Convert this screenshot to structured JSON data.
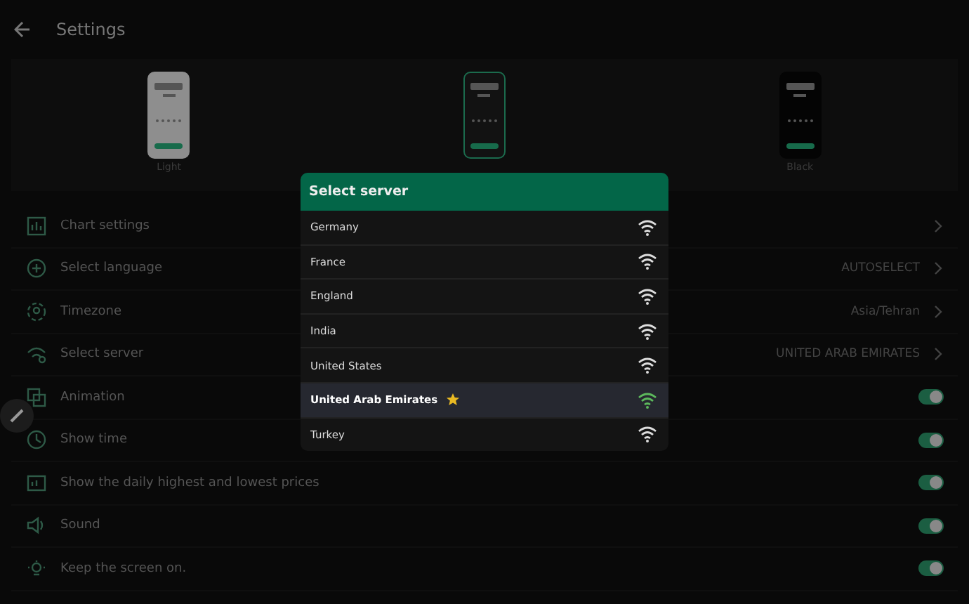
{
  "header": {
    "title": "Settings"
  },
  "themes": [
    {
      "label": "Light",
      "selected": false,
      "kind": "light"
    },
    {
      "selected": true,
      "kind": "dark"
    },
    {
      "label": "Black",
      "selected": false,
      "kind": "black"
    }
  ],
  "settings": [
    {
      "label": "Chart settings",
      "kind": "link"
    },
    {
      "label": "Select language",
      "kind": "link",
      "value": "AUTOSELECT"
    },
    {
      "label": "Timezone",
      "kind": "link",
      "value": "Asia/Tehran"
    },
    {
      "label": "Select server",
      "kind": "link",
      "value": "UNITED ARAB EMIRATES"
    },
    {
      "label": "Animation",
      "kind": "toggle",
      "on": true
    },
    {
      "label": "Show time",
      "kind": "toggle",
      "on": true
    },
    {
      "label": "Show the daily highest and lowest prices",
      "kind": "toggle",
      "on": true
    },
    {
      "label": "Sound",
      "kind": "toggle",
      "on": true
    },
    {
      "label": "Keep the screen on.",
      "kind": "toggle",
      "on": true
    }
  ],
  "dialog": {
    "title": "Select server",
    "servers": [
      {
        "name": "Germany",
        "selected": false,
        "favorite": false
      },
      {
        "name": "France",
        "selected": false,
        "favorite": false
      },
      {
        "name": "England",
        "selected": false,
        "favorite": false
      },
      {
        "name": "India",
        "selected": false,
        "favorite": false
      },
      {
        "name": "United States",
        "selected": false,
        "favorite": false
      },
      {
        "name": "United Arab Emirates",
        "selected": true,
        "favorite": true
      },
      {
        "name": "Turkey",
        "selected": false,
        "favorite": false
      }
    ]
  }
}
